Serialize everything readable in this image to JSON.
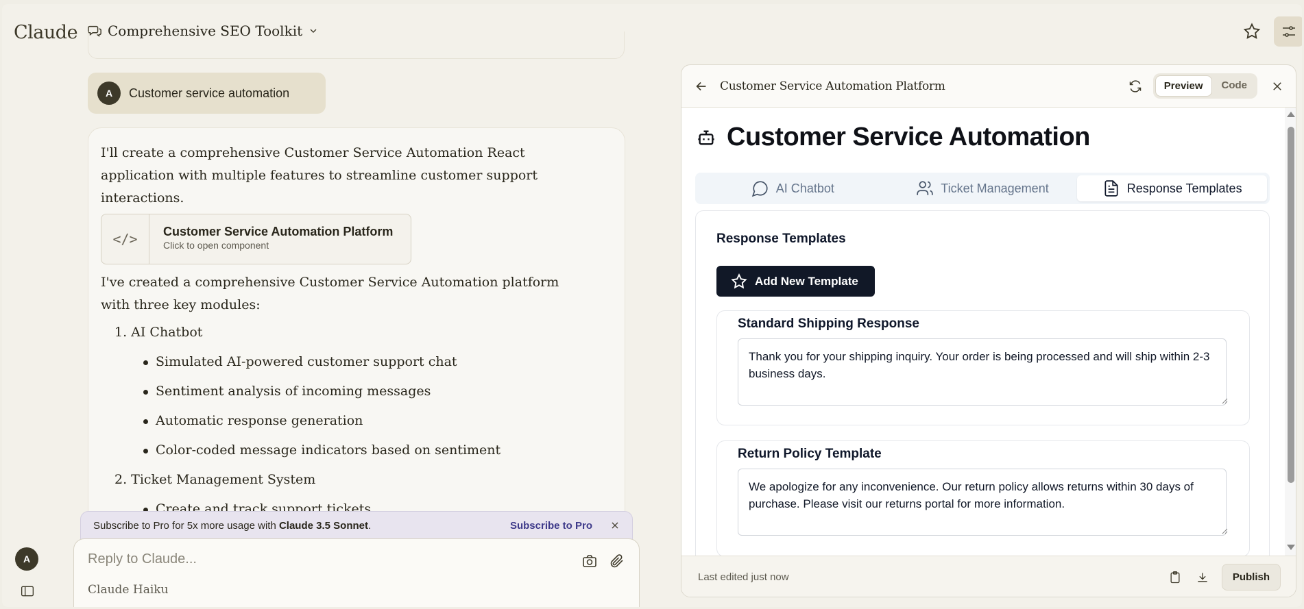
{
  "app": {
    "logo": "Claude",
    "project_title": "Comprehensive SEO Toolkit"
  },
  "user_message": {
    "avatar_initial": "A",
    "text": "Customer service automation"
  },
  "assistant": {
    "intro": "I'll create a comprehensive Customer Service Automation React application with multiple features to streamline customer support interactions.",
    "artifact_card": {
      "title": "Customer Service Automation Platform",
      "subtitle": "Click to open component",
      "icon": "</>"
    },
    "summary": "I've created a comprehensive Customer Service Automation platform with three key modules:",
    "modules": [
      {
        "label": "1. AI Chatbot",
        "features": [
          "Simulated AI-powered customer support chat",
          "Sentiment analysis of incoming messages",
          "Automatic response generation",
          "Color-coded message indicators based on sentiment"
        ]
      },
      {
        "label": "2. Ticket Management System",
        "features": [
          "Create and track support tickets"
        ]
      }
    ]
  },
  "promo": {
    "text_prefix": "Subscribe to Pro for 5x more usage with ",
    "text_bold": "Claude 3.5 Sonnet",
    "text_suffix": ".",
    "link": "Subscribe to Pro"
  },
  "composer": {
    "placeholder": "Reply to Claude...",
    "model": "Claude Haiku"
  },
  "sidebar": {
    "avatar_initial": "A"
  },
  "artifact_panel": {
    "title": "Customer Service Automation Platform",
    "view_toggle": {
      "preview": "Preview",
      "code": "Code",
      "active": "Preview"
    },
    "footer": {
      "edited": "Last edited just now",
      "publish": "Publish"
    },
    "app": {
      "heading": "Customer Service Automation",
      "tabs": [
        {
          "label": "AI Chatbot",
          "icon": "message-circle-icon"
        },
        {
          "label": "Ticket Management",
          "icon": "users-icon"
        },
        {
          "label": "Response Templates",
          "icon": "file-text-icon",
          "active": true
        }
      ],
      "section_title": "Response Templates",
      "add_button": "Add New Template",
      "templates": [
        {
          "name": "Standard Shipping Response",
          "body": "Thank you for your shipping inquiry. Your order is being processed and will ship within 2-3 business days."
        },
        {
          "name": "Return Policy Template",
          "body": "We apologize for any inconvenience. Our return policy allows returns within 30 days of purchase. Please visit our returns portal for more information."
        }
      ]
    }
  }
}
